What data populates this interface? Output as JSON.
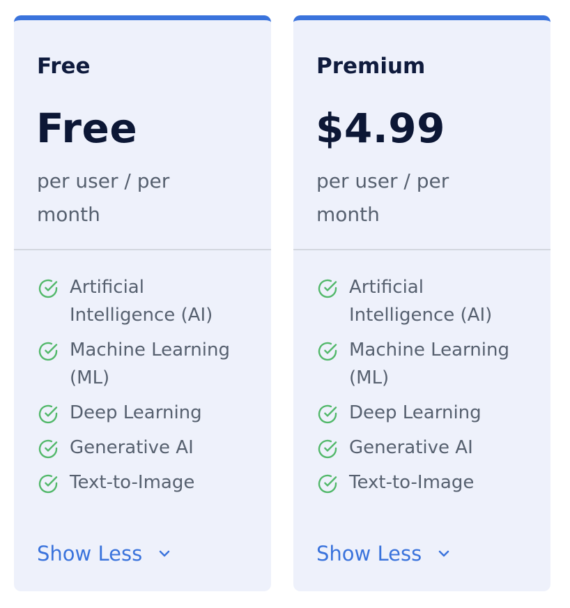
{
  "colors": {
    "accent": "#3a73dc",
    "card_background": "#eef1fb",
    "check": "#52b86a",
    "muted_text": "#56606f",
    "heading_text": "#0f1b3d"
  },
  "plans": [
    {
      "name": "Free",
      "price": "Free",
      "period": "per user / per month",
      "features": [
        "Artificial Intelligence (AI)",
        "Machine Learning (ML)",
        "Deep Learning",
        "Generative AI",
        "Text-to-Image"
      ],
      "toggle_label": "Show Less",
      "toggle_icon": "chevron-down-icon",
      "feature_icon": "check-circle-icon"
    },
    {
      "name": "Premium",
      "price": "$4.99",
      "period": "per user / per month",
      "features": [
        "Artificial Intelligence (AI)",
        "Machine Learning (ML)",
        "Deep Learning",
        "Generative AI",
        "Text-to-Image"
      ],
      "toggle_label": "Show Less",
      "toggle_icon": "chevron-down-icon",
      "feature_icon": "check-circle-icon"
    }
  ]
}
